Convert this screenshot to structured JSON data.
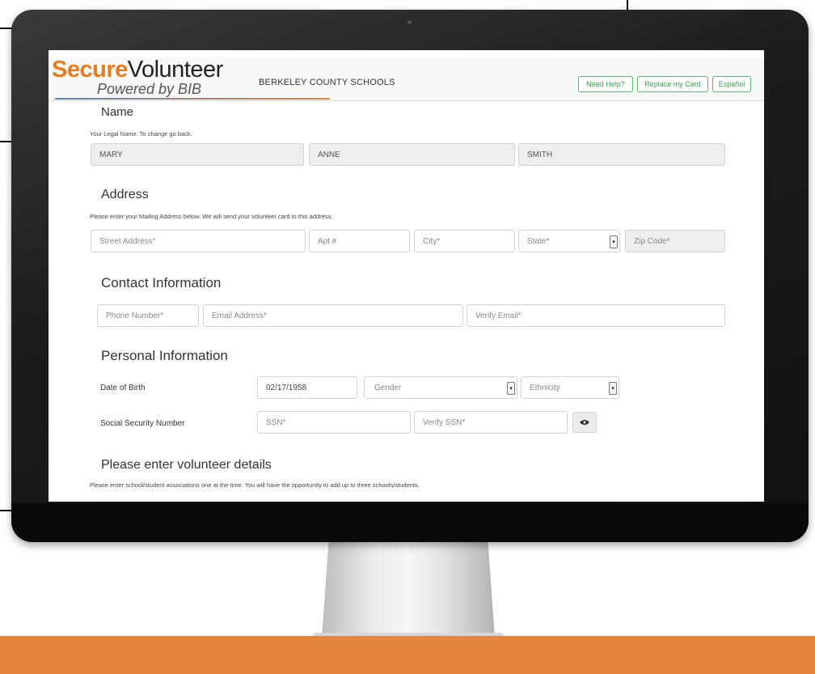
{
  "header": {
    "logo_secure": "Secure",
    "logo_volunteer": "Volunteer",
    "logo_powered": "Powered by BIB",
    "organization": "BERKELEY COUNTY SCHOOLS",
    "buttons": {
      "help": "Need Help?",
      "replace_card": "Replace my Card",
      "spanish": "Español"
    }
  },
  "name_section": {
    "title": "Name",
    "hint": "Your Legal Name. To change go back.",
    "first": "MARY",
    "middle": "ANNE",
    "last": "SMITH"
  },
  "address_section": {
    "title": "Address",
    "hint": "Please enter your Mailing Address below. We will send your volunteer card to this address.",
    "street_placeholder": "Street Address*",
    "apt_placeholder": "Apt #",
    "city_placeholder": "City*",
    "state_placeholder": "State*",
    "zip_placeholder": "Zip Code*"
  },
  "contact_section": {
    "title": "Contact Information",
    "phone_placeholder": "Phone Number*",
    "email_placeholder": "Email Address*",
    "verify_email_placeholder": "Verify Email*"
  },
  "personal_section": {
    "title": "Personal Information",
    "dob_label": "Date of Birth",
    "dob_value": "02/17/1958",
    "gender_placeholder": "Gender",
    "ethnicity_placeholder": "Ethnicity",
    "ssn_label": "Social Security Number",
    "ssn_placeholder": "SSN*",
    "verify_ssn_placeholder": "Verify SSN*"
  },
  "volunteer_section": {
    "title": "Please enter volunteer details",
    "hint": "Please enter school/student associations one at the time. You will have the opportunity to add up to three schools/students."
  },
  "colors": {
    "brand_orange": "#e87b1e",
    "button_green": "#3a9c4a",
    "band_orange": "#e3833c"
  },
  "icons": {
    "show_ssn": "eye-icon",
    "select": "caret-icon"
  }
}
